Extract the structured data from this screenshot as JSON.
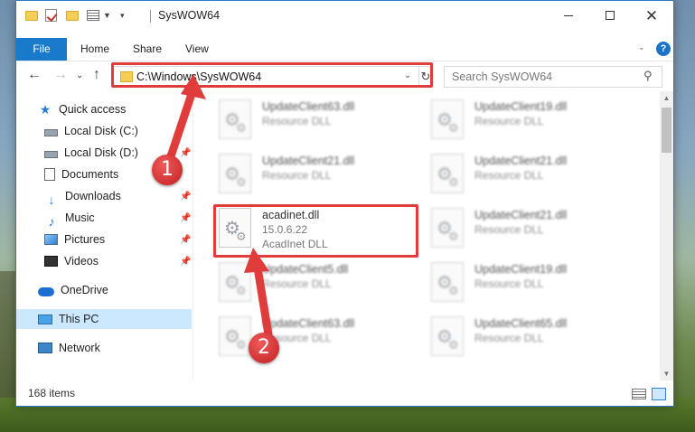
{
  "window": {
    "title": "SysWOW64"
  },
  "ribbon": {
    "tabs": [
      "File",
      "Home",
      "Share",
      "View"
    ],
    "help": "?"
  },
  "address": {
    "path": "C:\\Windows\\SysWOW64",
    "search_placeholder": "Search SysWOW64"
  },
  "nav": {
    "items": [
      {
        "label": "Quick access",
        "icon": "star-icon"
      },
      {
        "label": "Local Disk (C:)",
        "icon": "disk-icon"
      },
      {
        "label": "Local Disk (D:)",
        "icon": "disk-icon"
      },
      {
        "label": "Documents",
        "icon": "documents-icon"
      },
      {
        "label": "Downloads",
        "icon": "downloads-icon"
      },
      {
        "label": "Music",
        "icon": "music-icon"
      },
      {
        "label": "Pictures",
        "icon": "pictures-icon"
      },
      {
        "label": "Videos",
        "icon": "videos-icon"
      },
      {
        "label": "OneDrive",
        "icon": "onedrive-icon"
      },
      {
        "label": "This PC",
        "icon": "this-pc-icon"
      },
      {
        "label": "Network",
        "icon": "network-icon"
      }
    ]
  },
  "files": {
    "items": [
      {
        "name": "UpdateClient63.dll",
        "type": "Resource DLL"
      },
      {
        "name": "UpdateClient19.dll",
        "type": "Resource DLL"
      },
      {
        "name": "UpdateClient21.dll",
        "type": "Resource DLL"
      },
      {
        "name": "UpdateClient21.dll",
        "type": "Resource DLL"
      },
      {
        "name": "acadinet.dll",
        "version": "15.0.6.22",
        "type": "AcadInet DLL"
      },
      {
        "name": "UpdateClient21.dll",
        "type": "Resource DLL"
      },
      {
        "name": "UpdateClient5.dll",
        "type": "Resource DLL"
      },
      {
        "name": "UpdateClient19.dll",
        "type": "Resource DLL"
      },
      {
        "name": "UpdateClient63.dll",
        "type": "Resource DLL"
      },
      {
        "name": "UpdateClient65.dll",
        "type": "Resource DLL"
      }
    ]
  },
  "status": {
    "item_count": "168 items"
  },
  "annotations": {
    "step1": "1",
    "step2": "2",
    "color": "#e03c3c"
  }
}
